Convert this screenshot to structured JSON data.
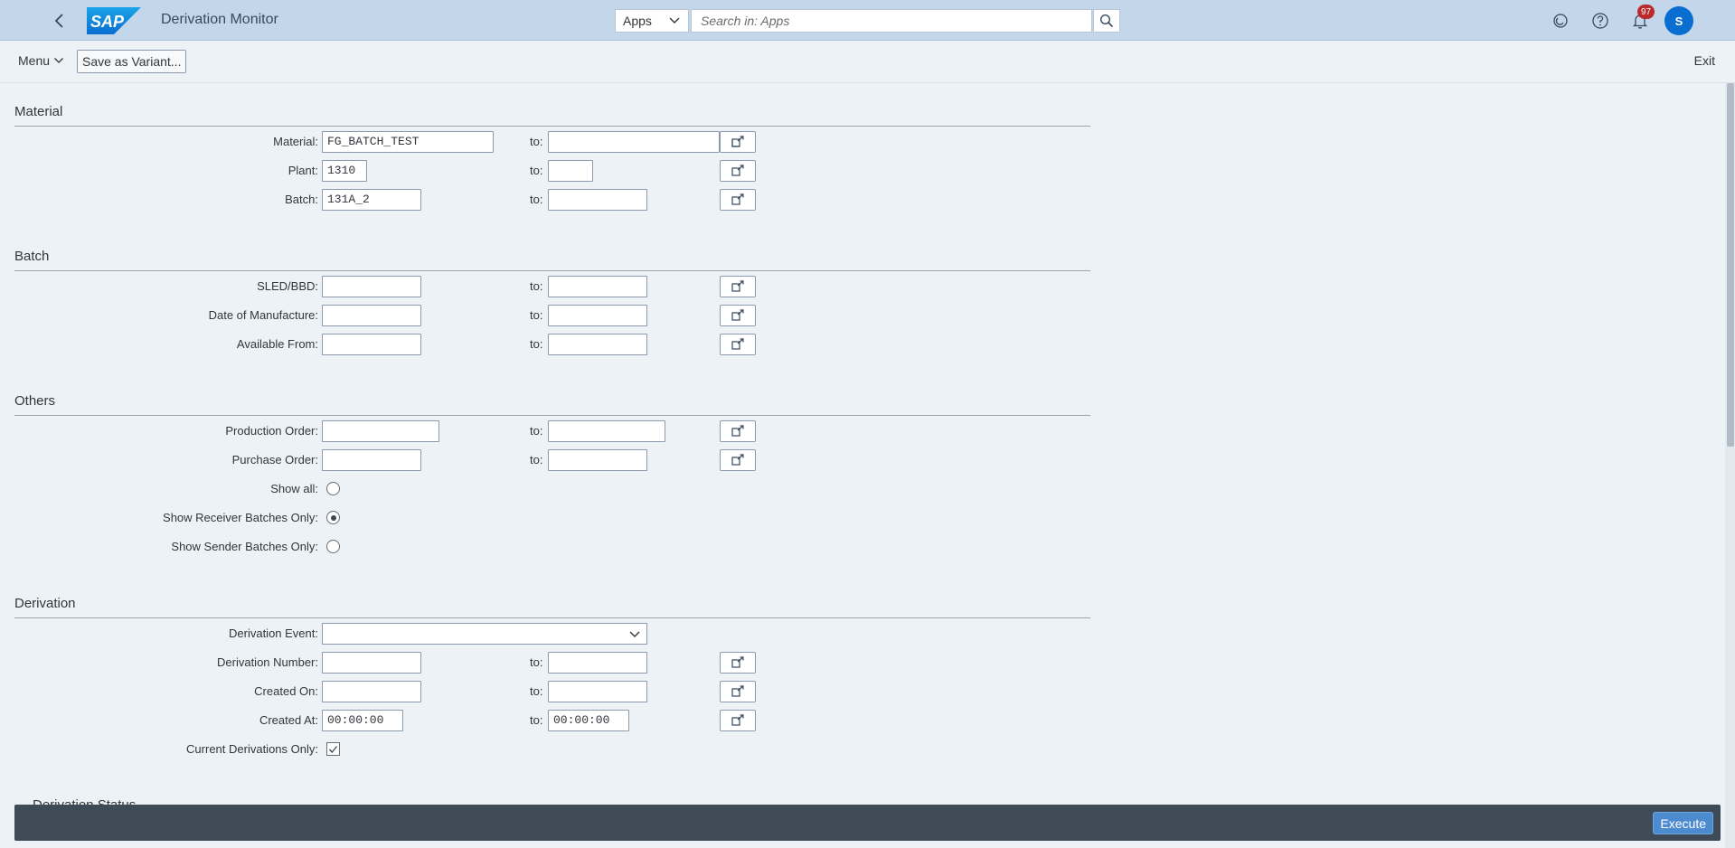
{
  "shell": {
    "title": "Derivation Monitor",
    "logo_text": "SAP",
    "scope": "Apps",
    "search_placeholder": "Search in: Apps",
    "notification_count": "97",
    "avatar_initial": "S"
  },
  "toolbar": {
    "menu": "Menu",
    "save_variant": "Save as Variant...",
    "exit": "Exit"
  },
  "to_label": "to:",
  "sections": {
    "material": {
      "title": "Material",
      "material_label": "Material:",
      "material_from": "FG_BATCH_TEST",
      "material_to": "",
      "plant_label": "Plant:",
      "plant_from": "1310",
      "plant_to": "",
      "batch_label": "Batch:",
      "batch_from": "131A_2",
      "batch_to": ""
    },
    "batch": {
      "title": "Batch",
      "sled_label": "SLED/BBD:",
      "sled_from": "",
      "sled_to": "",
      "mfg_label": "Date of Manufacture:",
      "mfg_from": "",
      "mfg_to": "",
      "avail_label": "Available From:",
      "avail_from": "",
      "avail_to": ""
    },
    "others": {
      "title": "Others",
      "prod_label": "Production Order:",
      "prod_from": "",
      "prod_to": "",
      "purch_label": "Purchase Order:",
      "purch_from": "",
      "purch_to": "",
      "show_all_label": "Show all:",
      "show_receiver_label": "Show Receiver Batches Only:",
      "show_sender_label": "Show Sender Batches Only:",
      "selected_option": "Show Receiver Batches Only"
    },
    "derivation": {
      "title": "Derivation",
      "event_label": "Derivation Event:",
      "event_value": "",
      "number_label": "Derivation Number:",
      "number_from": "",
      "number_to": "",
      "created_on_label": "Created On:",
      "created_on_from": "",
      "created_on_to": "",
      "created_at_label": "Created At:",
      "created_at_from": "00:00:00",
      "created_at_to": "00:00:00",
      "current_only_label": "Current Derivations Only:",
      "current_only_checked": true
    },
    "status": {
      "title": "Derivation Status"
    }
  },
  "footer": {
    "execute": "Execute"
  },
  "colors": {
    "shell_bg": "#c4d6ea",
    "page_bg": "#edf2f7",
    "footer_bg": "#3e4b57",
    "accent": "#0a6ed1",
    "badge": "#bb2b2b"
  }
}
